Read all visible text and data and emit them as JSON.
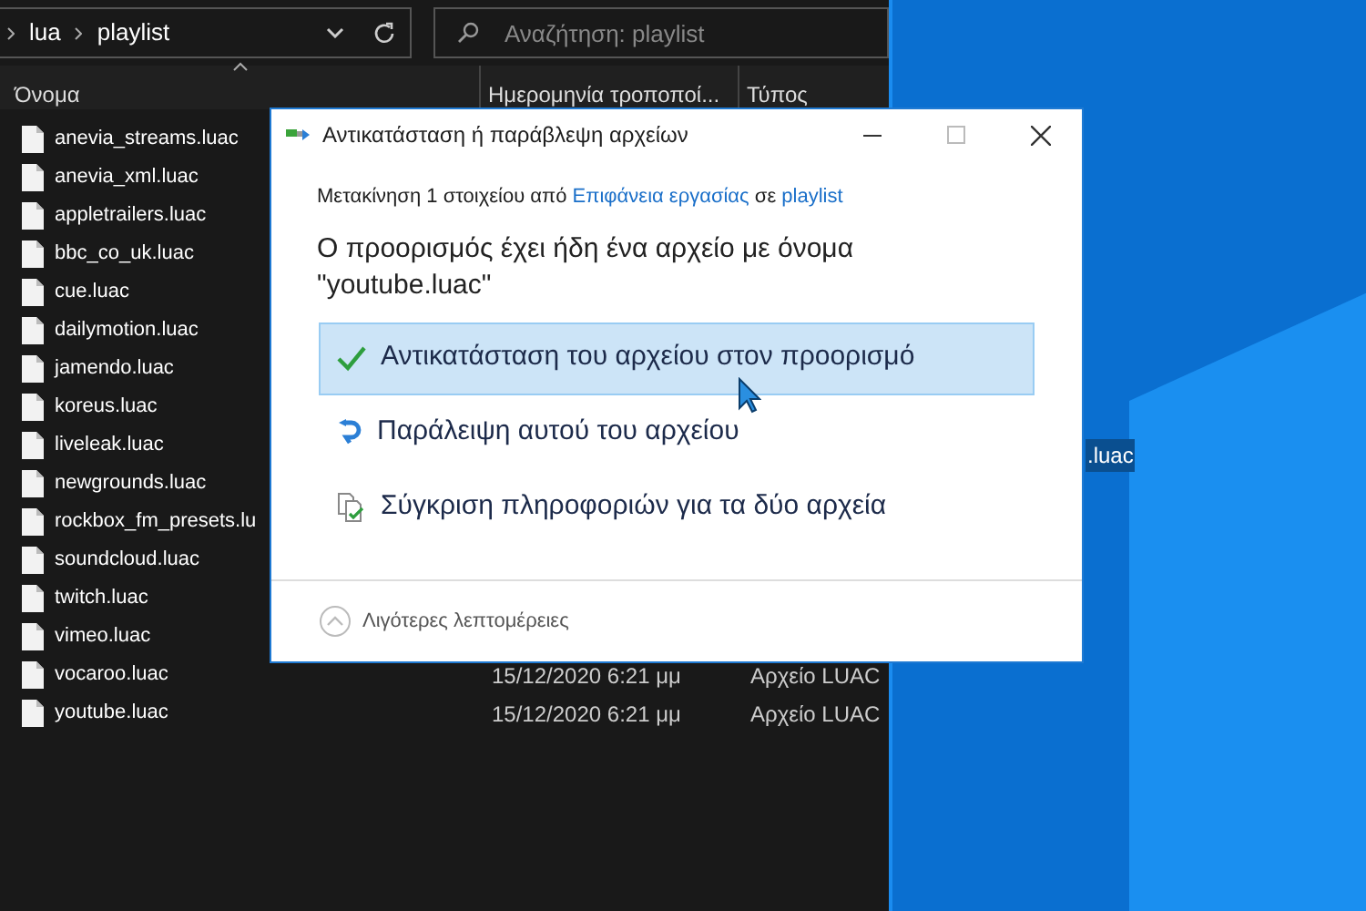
{
  "explorer": {
    "breadcrumb": [
      "lua",
      "playlist"
    ],
    "search": {
      "placeholder": "Αναζήτηση: playlist"
    },
    "columns": [
      "Όνομα",
      "Ημερομηνία τροποποί...",
      "Τύπος"
    ],
    "files": [
      {
        "name": "anevia_streams.luac"
      },
      {
        "name": "anevia_xml.luac"
      },
      {
        "name": "appletrailers.luac"
      },
      {
        "name": "bbc_co_uk.luac"
      },
      {
        "name": "cue.luac"
      },
      {
        "name": "dailymotion.luac"
      },
      {
        "name": "jamendo.luac"
      },
      {
        "name": "koreus.luac"
      },
      {
        "name": "liveleak.luac"
      },
      {
        "name": "newgrounds.luac"
      },
      {
        "name": "rockbox_fm_presets.lu"
      },
      {
        "name": "soundcloud.luac"
      },
      {
        "name": "twitch.luac"
      },
      {
        "name": "vimeo.luac"
      },
      {
        "name": "vocaroo.luac",
        "date": "15/12/2020 6:21 μμ",
        "type": "Αρχείο LUAC"
      },
      {
        "name": "youtube.luac",
        "date": "15/12/2020 6:21 μμ",
        "type": "Αρχείο LUAC"
      }
    ]
  },
  "desktop": {
    "icon_label": ".luac"
  },
  "dialog": {
    "title": "Αντικατάσταση ή παράβλεψη αρχείων",
    "subtitle": {
      "prefix": "Μετακίνηση 1 στοιχείου από",
      "source": "Επιφάνεια εργασίας",
      "middle": "σε",
      "target": "playlist"
    },
    "heading": "Ο προορισμός έχει ήδη ένα αρχείο με όνομα \"youtube.luac\"",
    "options": [
      {
        "kind": "replace",
        "label": "Αντικατάσταση του αρχείου στον προορισμό",
        "selected": true
      },
      {
        "kind": "skip",
        "label": "Παράλειψη αυτού του αρχείου",
        "selected": false
      },
      {
        "kind": "compare",
        "label": "Σύγκριση πληροφοριών για τα δύο αρχεία",
        "selected": false
      }
    ],
    "details_toggle": "Λιγότερες λεπτομέρειες"
  }
}
